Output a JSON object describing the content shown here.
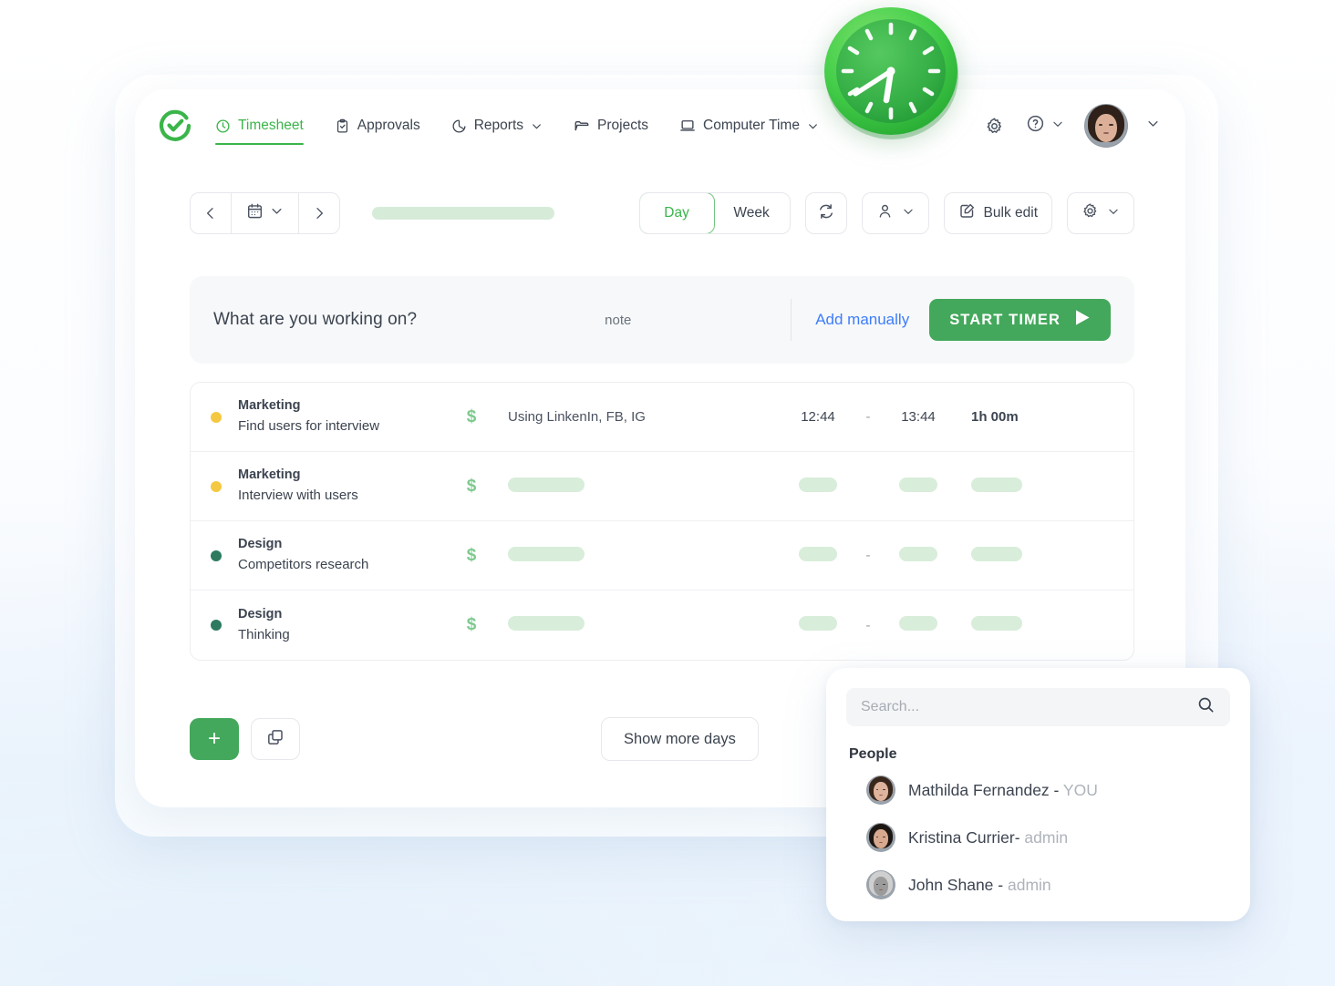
{
  "brand": {
    "logo_name": "clockify-check-logo",
    "accent": "#3bb54a",
    "green_button": "#43a85b",
    "link_blue": "#3d7dfb"
  },
  "nav": {
    "items": [
      {
        "label": "Timesheet",
        "icon": "clock-icon",
        "active": true,
        "caret": false
      },
      {
        "label": "Approvals",
        "icon": "clipboard-check-icon",
        "active": false,
        "caret": false
      },
      {
        "label": "Reports",
        "icon": "pie-chart-icon",
        "active": false,
        "caret": true
      },
      {
        "label": "Projects",
        "icon": "folder-icon",
        "active": false,
        "caret": false
      },
      {
        "label": "Computer Time",
        "icon": "laptop-icon",
        "active": false,
        "caret": true
      }
    ],
    "right": {
      "settings_icon": "gear-icon",
      "help_icon": "question-circle-icon",
      "help_caret": "chevron-down-icon",
      "avatar_name": "user-avatar",
      "avatar_caret": "chevron-down-icon"
    }
  },
  "toolbar": {
    "prev_label": "‹",
    "next_label": "›",
    "calendar_icon": "calendar-icon",
    "calendar_caret": "chevron-down-icon",
    "date_value": "",
    "view_day": "Day",
    "view_week": "Week",
    "active_view": "Day",
    "refresh_icon": "refresh-icon",
    "person_icon": "person-icon",
    "person_caret": "chevron-down-icon",
    "bulk_edit_label": "Bulk edit",
    "bulk_edit_icon": "edit-square-icon",
    "settings_icon": "gear-icon",
    "settings_caret": "chevron-down-icon"
  },
  "timer": {
    "placeholder": "What are you working on?",
    "note_label": "note",
    "add_manually": "Add manually",
    "start_timer": "START TIMER",
    "play_icon": "play-icon"
  },
  "entries": {
    "money_symbol": "$",
    "rows": [
      {
        "dot_color": "#f5c842",
        "dot_name": "status-dot-yellow",
        "project": "Marketing",
        "description": "Find users for interview",
        "note": "Using LinkenIn, FB, IG",
        "note_masked": false,
        "start": "12:44",
        "dash": "-",
        "end": "13:44",
        "duration": "1h 00m",
        "times_masked": false
      },
      {
        "dot_color": "#f5c842",
        "dot_name": "status-dot-yellow",
        "project": "Marketing",
        "description": "Interview with users",
        "note": "",
        "note_masked": true,
        "start": "",
        "dash": "",
        "end": "",
        "duration": "",
        "times_masked": true
      },
      {
        "dot_color": "#2d7a5f",
        "dot_name": "status-dot-green",
        "project": "Design",
        "description": "Competitors research",
        "note": "",
        "note_masked": true,
        "start": "",
        "dash": "-",
        "end": "",
        "duration": "",
        "times_masked": true
      },
      {
        "dot_color": "#2d7a5f",
        "dot_name": "status-dot-green",
        "project": "Design",
        "description": "Thinking",
        "note": "",
        "note_masked": true,
        "start": "",
        "dash": "-",
        "end": "",
        "duration": "",
        "times_masked": true
      }
    ]
  },
  "footer": {
    "add_label": "+",
    "copy_icon": "copy-icon",
    "show_more_days": "Show more days"
  },
  "popover": {
    "search_placeholder": "Search...",
    "search_value": "",
    "search_icon": "search-icon",
    "section_title": "People",
    "people": [
      {
        "name": "Mathilda Fernandez -",
        "role": "YOU",
        "avatar": "avatar-mathilda"
      },
      {
        "name": "Kristina Currier-",
        "role": "admin",
        "avatar": "avatar-kristina"
      },
      {
        "name": "John Shane -",
        "role": "admin",
        "avatar": "avatar-john"
      }
    ]
  },
  "decor": {
    "clock_icon": "analog-clock-icon"
  }
}
